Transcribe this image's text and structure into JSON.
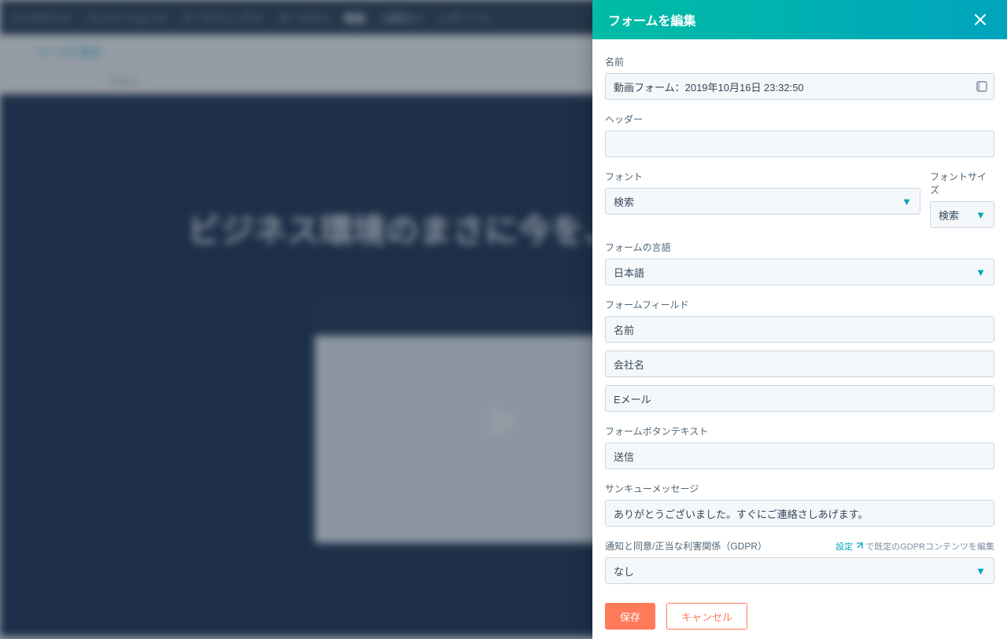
{
  "panel": {
    "title": "フォームを編集",
    "name_label": "名前",
    "name_value": "動画フォーム：2019年10月16日 23:32:50",
    "header_label": "ヘッダー",
    "header_value": "",
    "font_label": "フォント",
    "font_value": "検索",
    "font_size_label": "フォントサイズ",
    "font_size_value": "検索",
    "language_label": "フォームの言語",
    "language_value": "日本語",
    "fields_label": "フォームフィールド",
    "fields": [
      "名前",
      "会社名",
      "Eメール"
    ],
    "button_text_label": "フォームボタンテキスト",
    "button_text_value": "送信",
    "thankyou_label": "サンキューメッセージ",
    "thankyou_value": "ありがとうございました。すぐにご連絡さしあげます。",
    "gdpr_label": "通知と同意/正当な利害関係（GDPR）",
    "gdpr_hint_link": "設定",
    "gdpr_hint_rest": " で既定のGDPRコンテンツを編集",
    "gdpr_value": "なし",
    "save": "保存",
    "cancel": "キャンセル"
  },
  "bg": {
    "hero_title": "ビジネス環境のまさに今を、HubSpotで。",
    "back": "ページに戻る"
  }
}
